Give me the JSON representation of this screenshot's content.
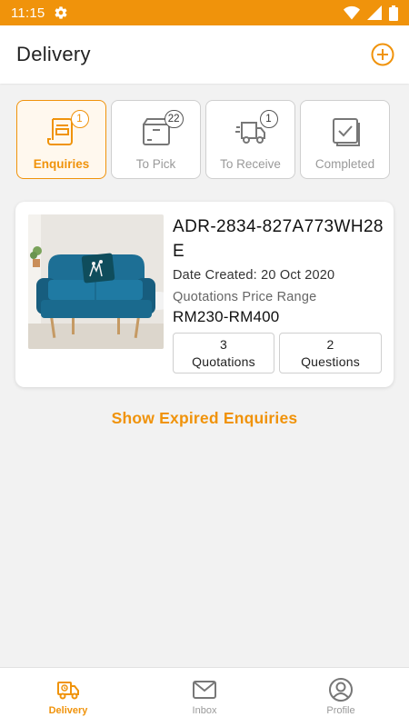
{
  "status_bar": {
    "time": "11:15"
  },
  "app_bar": {
    "title": "Delivery"
  },
  "tabs": [
    {
      "label": "Enquiries",
      "badge": "1",
      "active": true
    },
    {
      "label": "To Pick",
      "badge": "22",
      "active": false
    },
    {
      "label": "To Receive",
      "badge": "1",
      "active": false
    },
    {
      "label": "Completed",
      "badge": "",
      "active": false
    }
  ],
  "enquiry_card": {
    "id": "ADR-2834-827A773WH28E",
    "date_created": "Date Created: 20 Oct 2020",
    "price_range_label": "Quotations Price Range",
    "price_range": "RM230-RM400",
    "quotations_count": "3",
    "quotations_label": "Quotations",
    "questions_count": "2",
    "questions_label": "Questions"
  },
  "expired_link": "Show Expired Enquiries",
  "bottom_nav": [
    {
      "label": "Delivery",
      "icon": "delivery-icon",
      "active": true
    },
    {
      "label": "Inbox",
      "icon": "mail-icon",
      "active": false
    },
    {
      "label": "Profile",
      "icon": "profile-icon",
      "active": false
    }
  ],
  "colors": {
    "accent": "#f0930b",
    "background": "#f2f2f2",
    "sofa": "#1d6f95"
  }
}
